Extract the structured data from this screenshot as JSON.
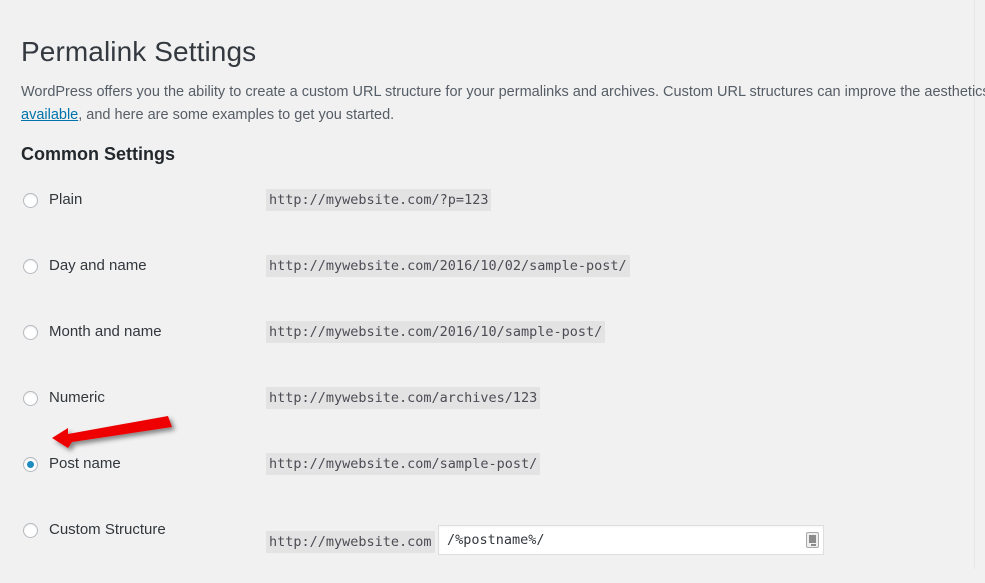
{
  "page": {
    "title": "Permalink Settings",
    "intro_before_link": "WordPress offers you the ability to create a custom URL structure for your permalinks and archives. Custom URL structures can improve the aesthetics, us",
    "intro_link": "tags are available",
    "intro_after_link": ", and here are some examples to get you started.",
    "section_title": "Common Settings"
  },
  "colors": {
    "background": "#f1f1f1",
    "code_background": "#e3e3e3",
    "link": "#0073aa",
    "radio_selected": "#1e8cbe",
    "arrow": "#ee0000",
    "heading": "#33393f"
  },
  "options": [
    {
      "label": "Plain",
      "url": "http://mywebsite.com/?p=123",
      "selected": false
    },
    {
      "label": "Day and name",
      "url": "http://mywebsite.com/2016/10/02/sample-post/",
      "selected": false
    },
    {
      "label": "Month and name",
      "url": "http://mywebsite.com/2016/10/sample-post/",
      "selected": false
    },
    {
      "label": "Numeric",
      "url": "http://mywebsite.com/archives/123",
      "selected": false
    },
    {
      "label": "Post name",
      "url": "http://mywebsite.com/sample-post/",
      "selected": true
    }
  ],
  "custom_structure": {
    "label": "Custom Structure",
    "prefix": "http://mywebsite.com",
    "value": "/%postname%/",
    "placeholder": "",
    "selected": false
  },
  "annotation": {
    "type": "arrow",
    "points_to": "post-name-radio",
    "color": "#ee0000"
  }
}
